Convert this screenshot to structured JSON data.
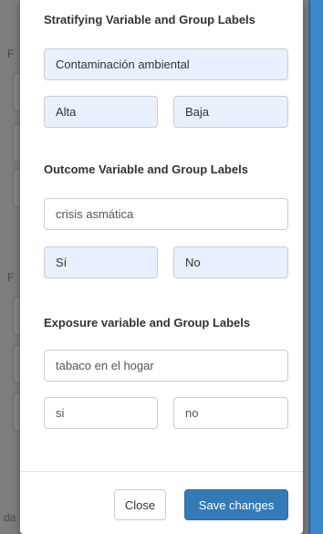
{
  "background": {
    "letters": [
      "F",
      "F",
      "da"
    ]
  },
  "stratifying": {
    "title": "Stratifying Variable and Group Labels",
    "variable_value": "Contaminación ambiental",
    "group1_value": "Alta",
    "group2_value": "Baja"
  },
  "outcome": {
    "title": "Outcome Variable and Group Labels",
    "variable_value": "crisis asmática",
    "group1_value": "Sí",
    "group2_value": "No"
  },
  "exposure": {
    "title": "Exposure variable and Group Labels",
    "variable_value": "tabaco en el hogar",
    "group1_value": "si",
    "group2_value": "no"
  },
  "footer": {
    "close_label": "Close",
    "save_label": "Save changes"
  },
  "colors": {
    "primary": "#337ab7",
    "autofill_bg": "#e8f0fe"
  }
}
